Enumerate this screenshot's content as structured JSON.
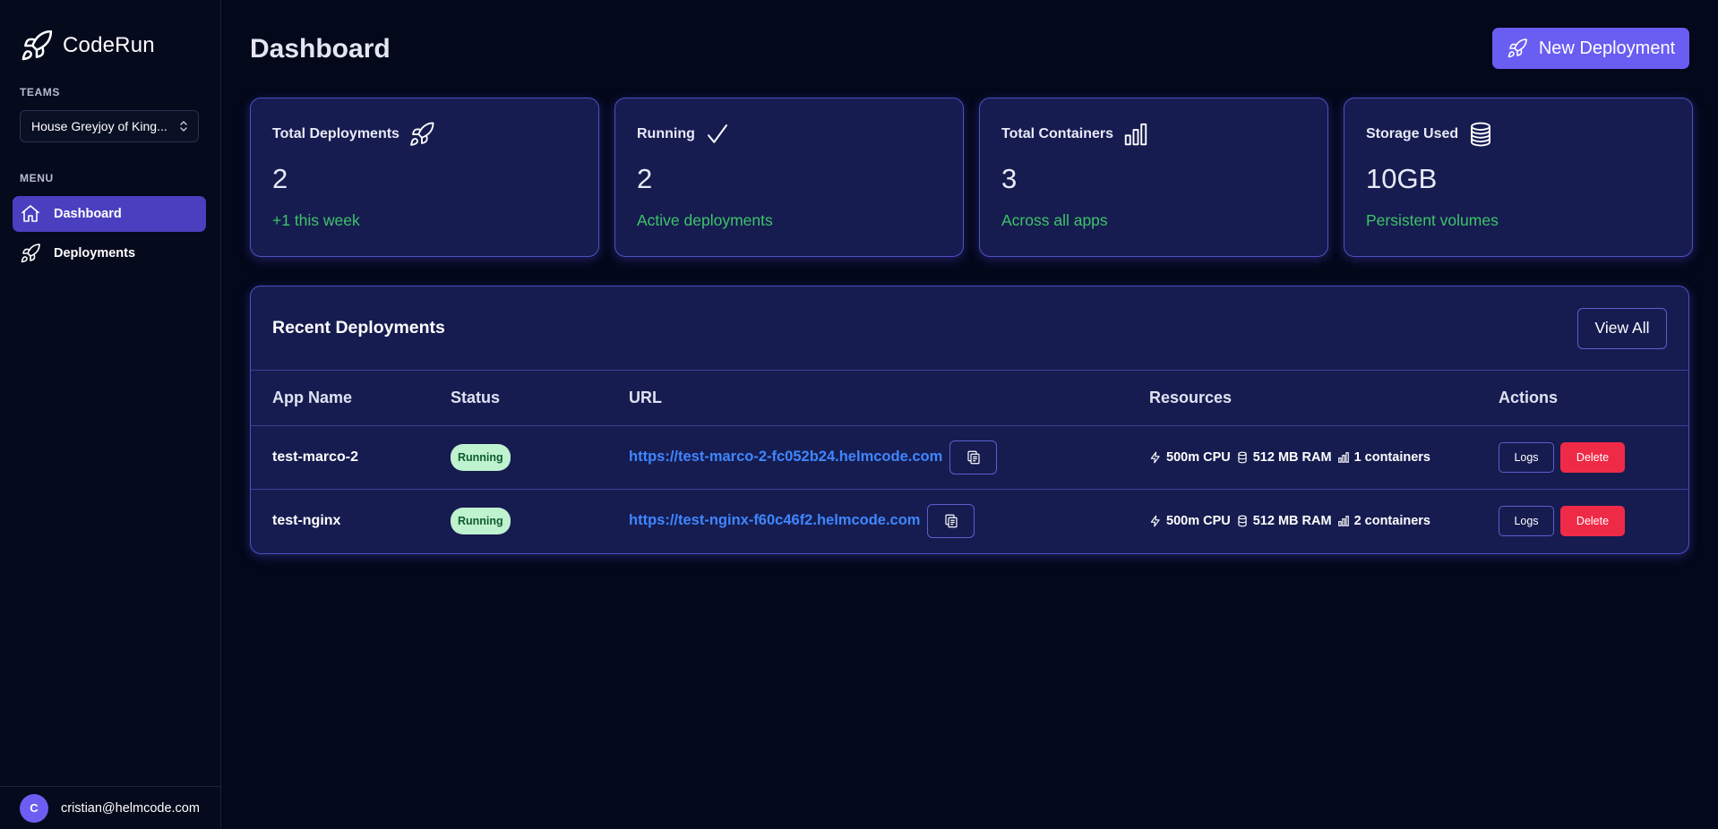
{
  "app": {
    "name": "CodeRun"
  },
  "sidebar": {
    "teams_label": "TEAMS",
    "team_selected": "House Greyjoy of King...",
    "menu_label": "MENU",
    "items": [
      {
        "label": "Dashboard",
        "icon": "home-icon",
        "active": true
      },
      {
        "label": "Deployments",
        "icon": "rocket-icon",
        "active": false
      }
    ],
    "user": {
      "initial": "C",
      "email": "cristian@helmcode.com"
    }
  },
  "header": {
    "title": "Dashboard",
    "new_deployment_label": "New Deployment"
  },
  "stats": [
    {
      "label": "Total Deployments",
      "icon": "rocket-icon",
      "value": "2",
      "sub": "+1 this week"
    },
    {
      "label": "Running",
      "icon": "check-icon",
      "value": "2",
      "sub": "Active deployments"
    },
    {
      "label": "Total Containers",
      "icon": "bar-chart-icon",
      "value": "3",
      "sub": "Across all apps"
    },
    {
      "label": "Storage Used",
      "icon": "database-icon",
      "value": "10GB",
      "sub": "Persistent volumes"
    }
  ],
  "recent": {
    "title": "Recent Deployments",
    "view_all_label": "View All",
    "columns": [
      "App Name",
      "Status",
      "URL",
      "Resources",
      "Actions"
    ],
    "rows": [
      {
        "name": "test-marco-2",
        "status": "Running",
        "url": "https://test-marco-2-fc052b24.helmcode.com",
        "cpu": "500m CPU",
        "ram": "512 MB RAM",
        "containers": "1 containers",
        "logs_label": "Logs",
        "delete_label": "Delete"
      },
      {
        "name": "test-nginx",
        "status": "Running",
        "url": "https://test-nginx-f60c46f2.helmcode.com",
        "cpu": "500m CPU",
        "ram": "512 MB RAM",
        "containers": "2 containers",
        "logs_label": "Logs",
        "delete_label": "Delete"
      }
    ]
  },
  "colors": {
    "accent": "#6a5df2",
    "active_nav": "#4a3fbf",
    "card_bg": "#161c50",
    "positive": "#3ec36a",
    "link": "#3f86ff",
    "danger": "#ef2a47"
  }
}
